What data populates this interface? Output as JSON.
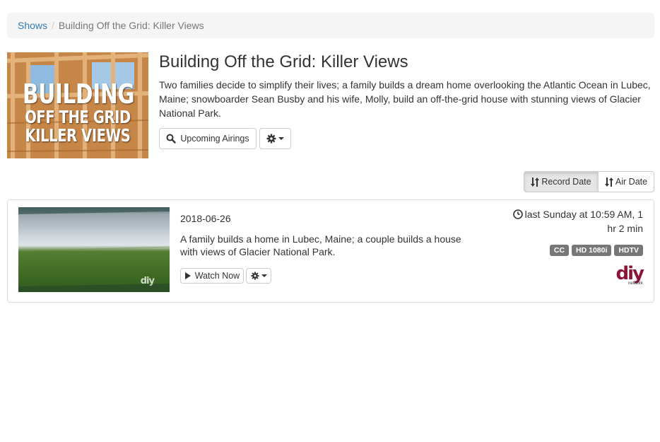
{
  "breadcrumb": {
    "shows_link": "Shows",
    "separator": "/",
    "current": "Building Off the Grid: Killer Views"
  },
  "show": {
    "poster_lines": [
      "BUILDING",
      "OFF THE GRID",
      "KILLER VIEWS"
    ],
    "title": "Building Off the Grid: Killer Views",
    "description": "Two families decide to simplify their lives; a family builds a dream home overlooking the Atlantic Ocean in Lubec, Maine; snowboarder Sean Busby and his wife, Molly, build an off-the-grid house with stunning views of Glacier National Park.",
    "upcoming_label": "Upcoming Airings"
  },
  "sort": {
    "record_date_label": "Record Date",
    "air_date_label": "Air Date",
    "active": "Record Date"
  },
  "episodes": [
    {
      "date": "2018-06-26",
      "description": "A family builds a home in Lubec, Maine; a couple builds a house with views of Glacier National Park.",
      "watch_label": "Watch Now",
      "time_text": "last Sunday at 10:59 AM, 1 hr 2 min",
      "badges": [
        "CC",
        "HD 1080i",
        "HDTV"
      ],
      "thumb_watermark": "diy",
      "network_logo": "diy",
      "network_sub": "network"
    }
  ],
  "icons": {
    "search": "search-icon",
    "gear": "gear-icon",
    "sort": "sort-icon",
    "play": "play-icon",
    "clock": "clock-icon"
  },
  "colors": {
    "link": "#337ab7",
    "badge": "#777777",
    "network_brand": "#8a1538",
    "active_sort_bg": "#e6e6e6"
  }
}
